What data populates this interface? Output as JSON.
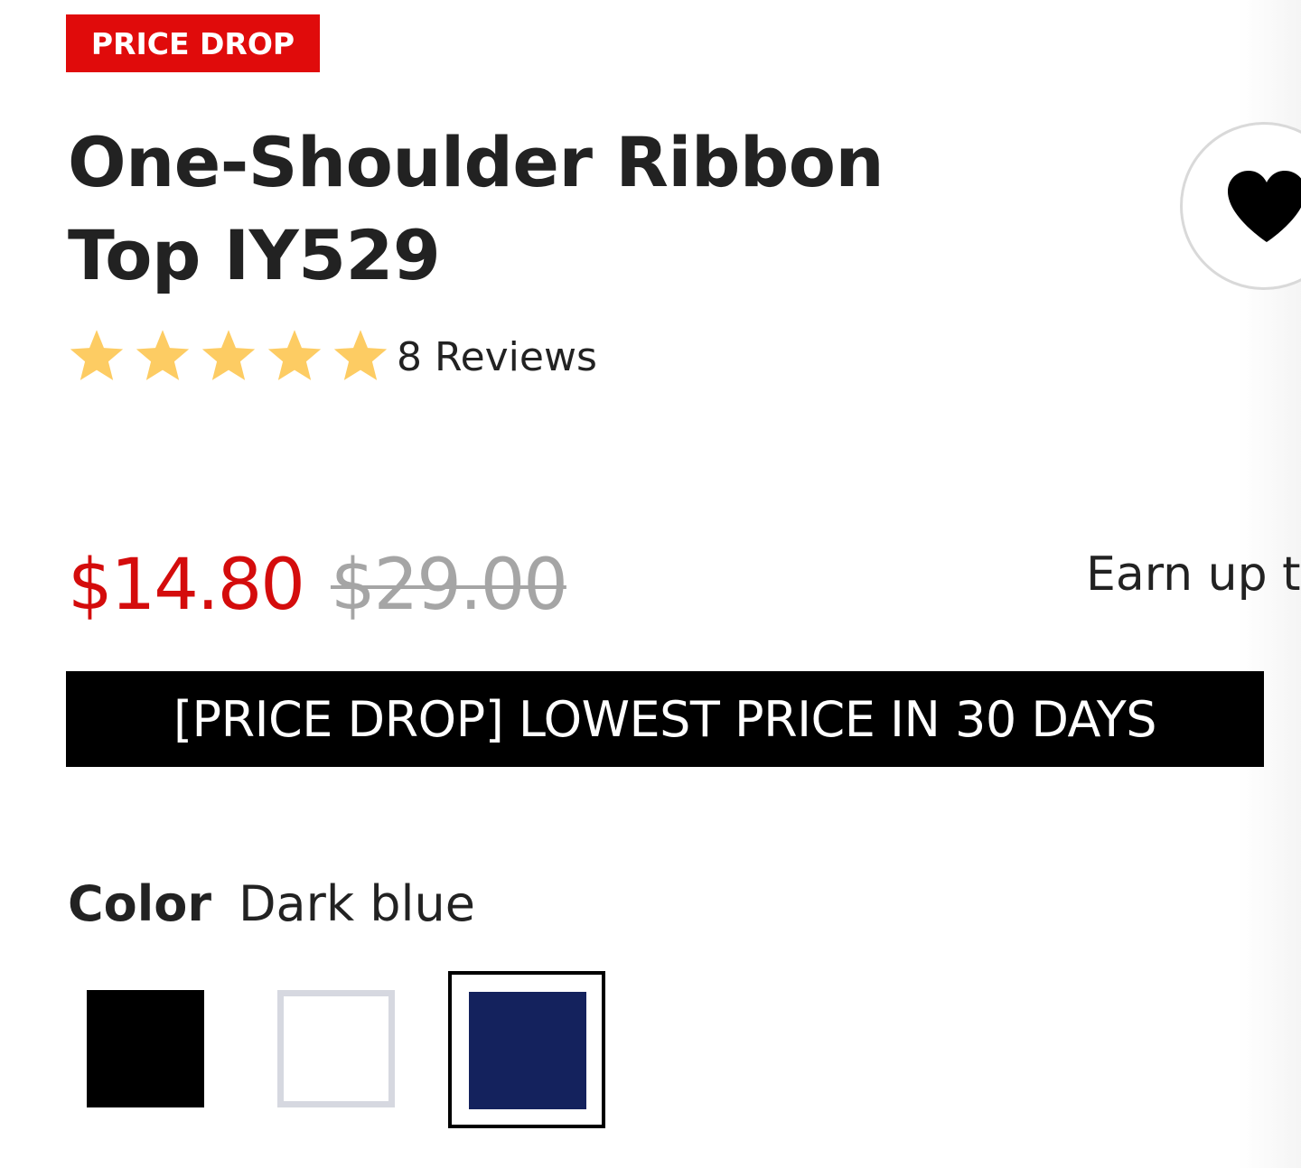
{
  "badge": {
    "label": "PRICE DROP",
    "color": "#e00b0b"
  },
  "product": {
    "title": "One-Shoulder Ribbon Top IY529"
  },
  "wishlist": {
    "icon": "heart-icon",
    "color": "#000000"
  },
  "rating": {
    "value": 5,
    "max": 5,
    "star_color": "#fdcc63",
    "reviews_label": "8 Reviews"
  },
  "price": {
    "sale": "$14.80",
    "original": "$29.00",
    "sale_color": "#d40c0c",
    "original_color": "#a5a5a5"
  },
  "rewards": {
    "text": "Earn up t"
  },
  "banner": {
    "text": "[PRICE DROP] LOWEST PRICE IN 30 DAYS",
    "background": "#000000"
  },
  "color": {
    "label": "Color",
    "selected_value": "Dark blue",
    "swatches": [
      {
        "name": "Black",
        "hex": "#000000",
        "selected": false
      },
      {
        "name": "White",
        "hex": "#ffffff",
        "border": "#d6d8e0",
        "selected": false
      },
      {
        "name": "Dark blue",
        "hex": "#14225d",
        "selected": true
      }
    ]
  }
}
